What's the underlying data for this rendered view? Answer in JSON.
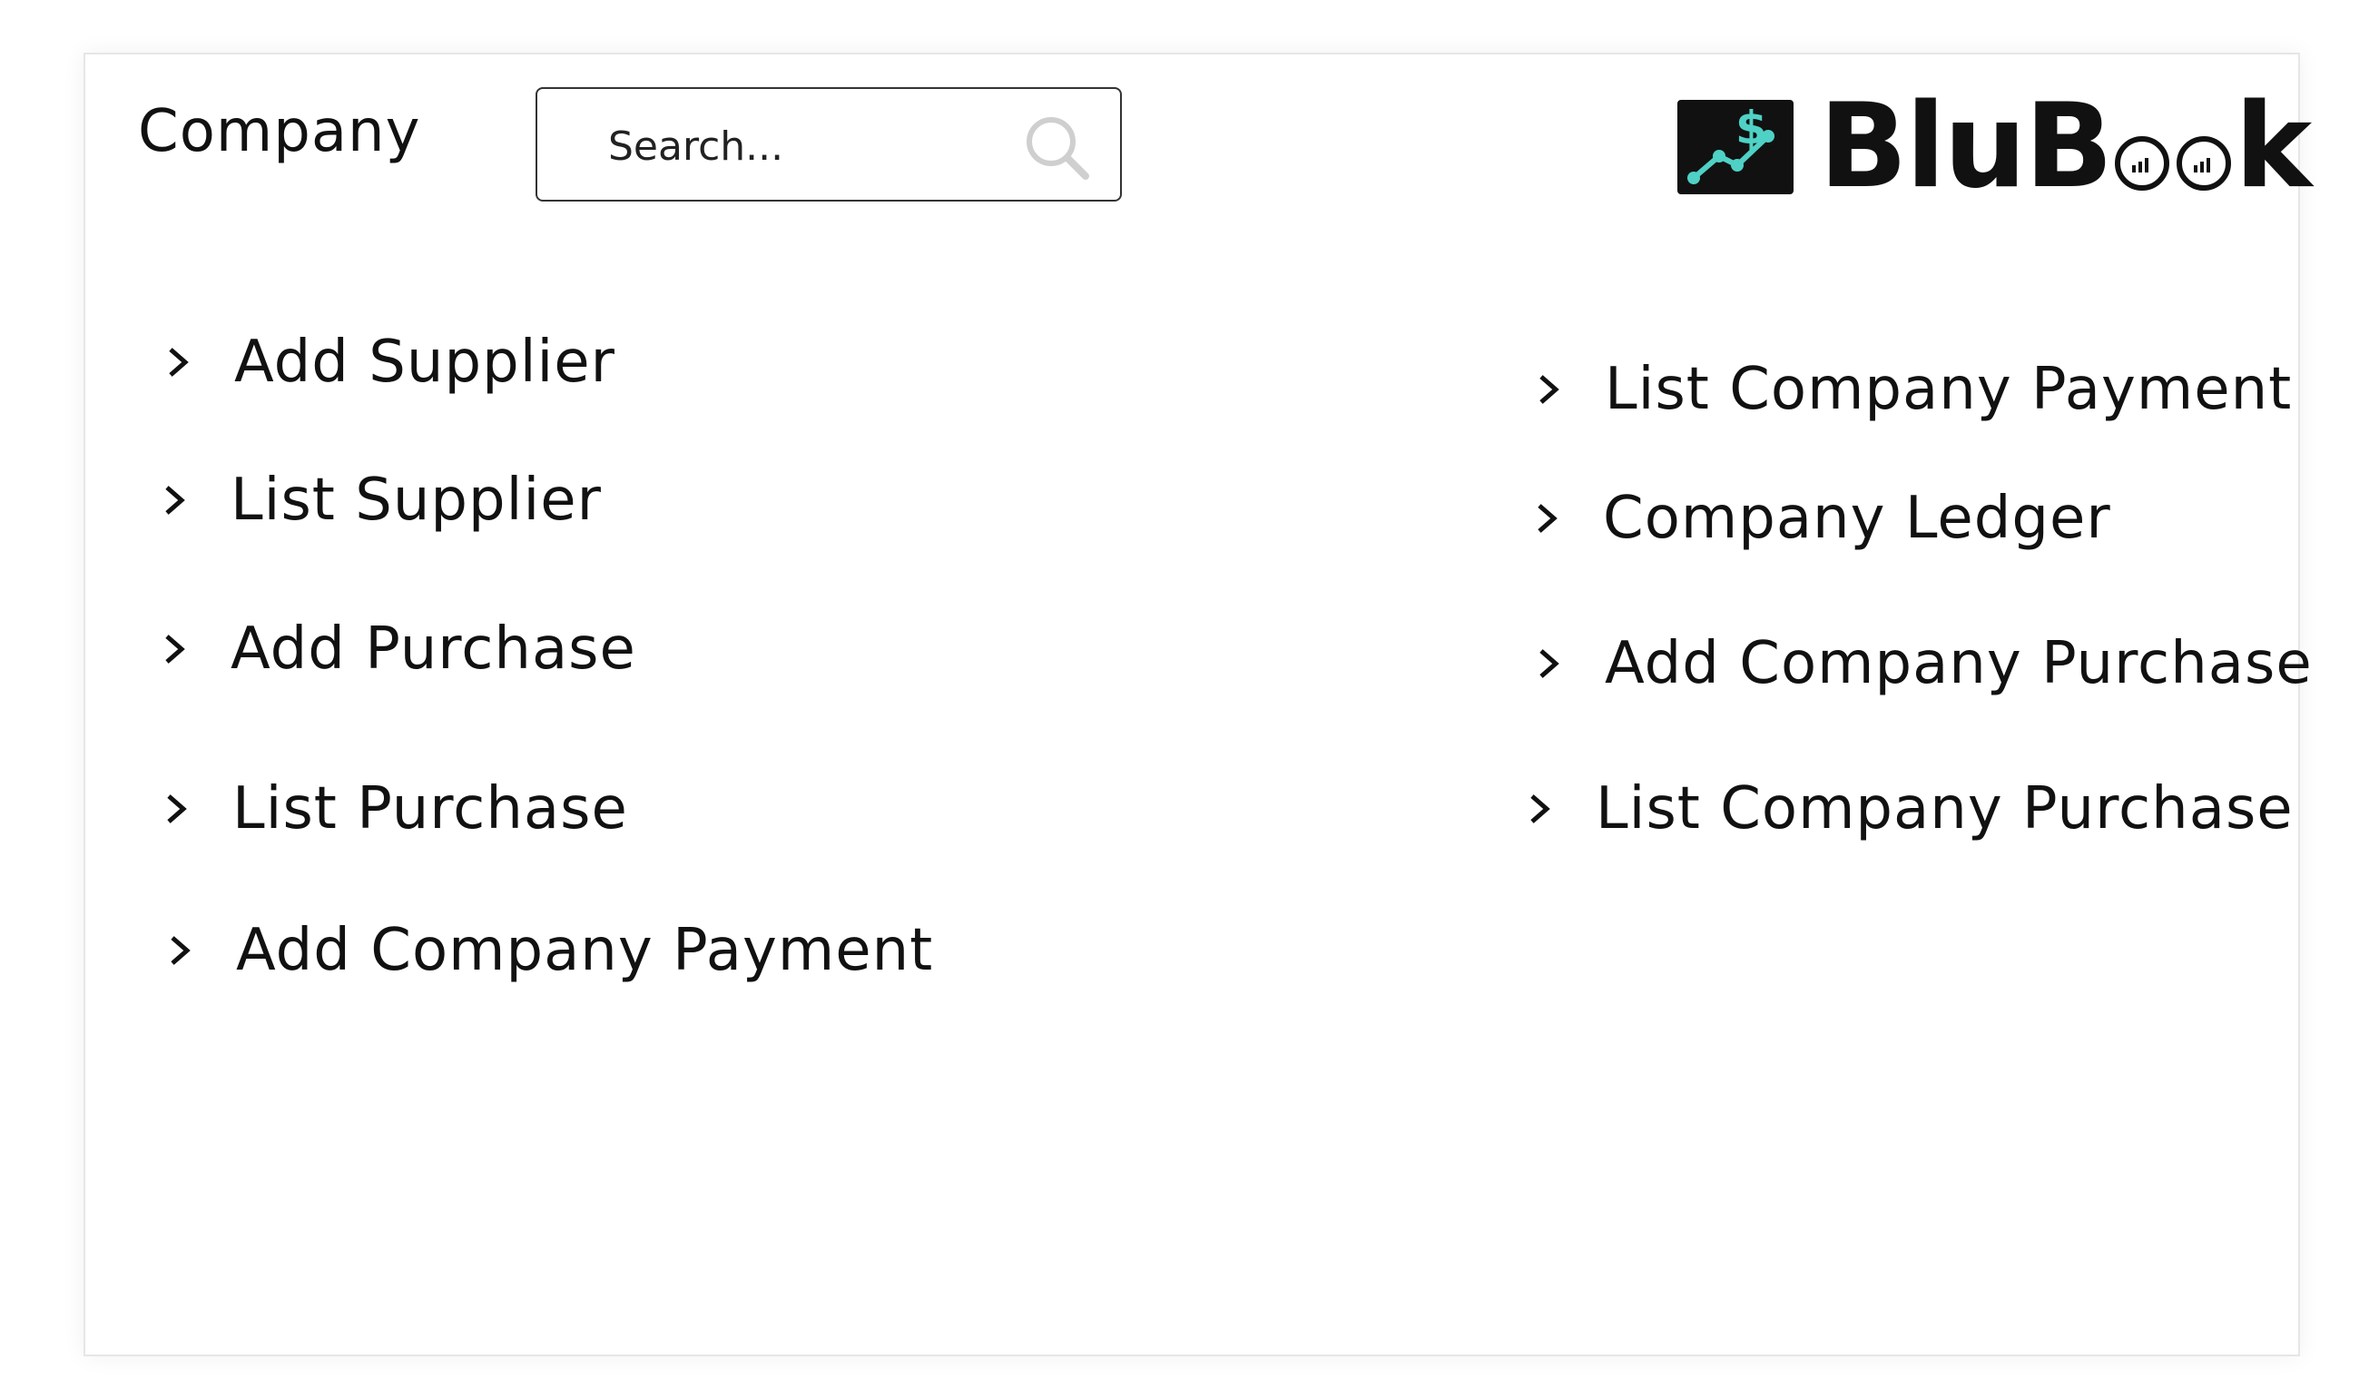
{
  "header": {
    "title": "Company",
    "search_placeholder": "Search...",
    "logo_text_prefix": "BluB",
    "logo_text_suffix": "k"
  },
  "menu": {
    "left": [
      {
        "label": "Add Supplier"
      },
      {
        "label": "List Supplier"
      },
      {
        "label": "Add Purchase"
      },
      {
        "label": "List Purchase"
      },
      {
        "label": "Add Company Payment"
      }
    ],
    "right": [
      {
        "label": "List Company Payment"
      },
      {
        "label": "Company Ledger"
      },
      {
        "label": "Add Company Purchase"
      },
      {
        "label": "List Company Purchase"
      }
    ]
  },
  "colors": {
    "accent": "#4fd1c5",
    "text": "#111111",
    "border": "#333333"
  },
  "icons": {
    "search": "search-icon",
    "chevron": "chevron-right-icon",
    "logo": "dollar-chart-icon"
  }
}
